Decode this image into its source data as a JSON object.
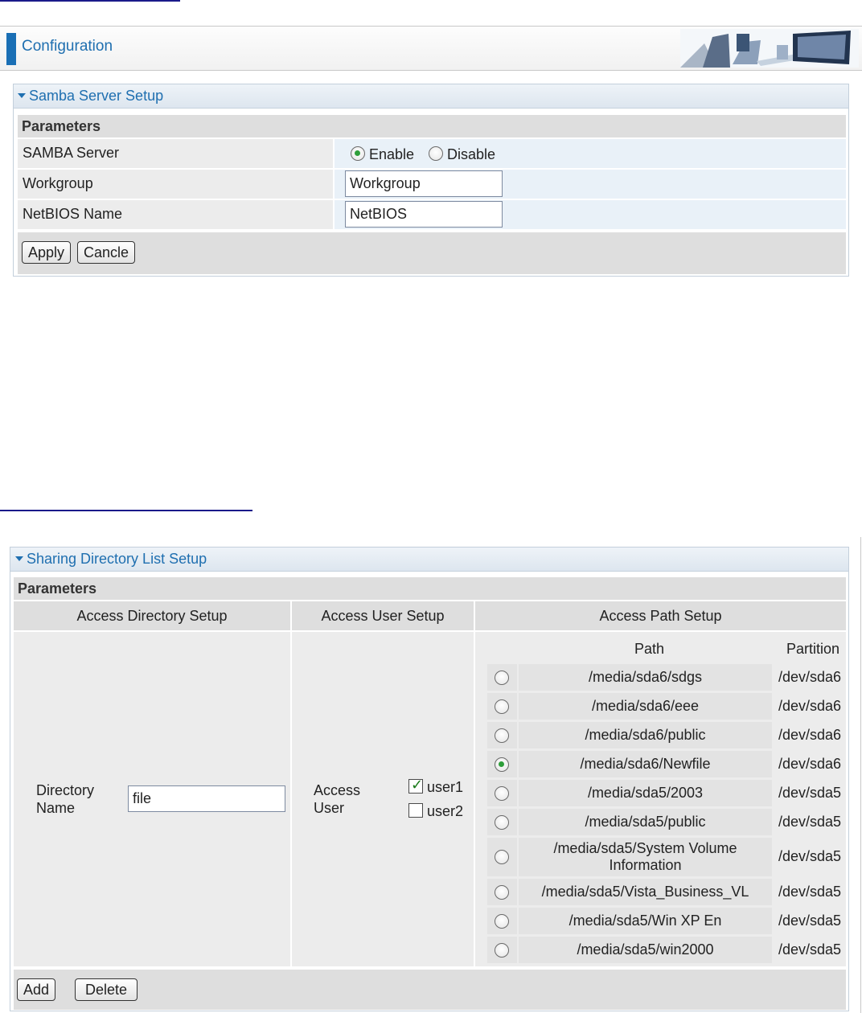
{
  "config": {
    "title": "Configuration"
  },
  "samba_panel": {
    "title": "Samba Server Setup",
    "params_label": "Parameters",
    "rows": {
      "samba_server": {
        "label": "SAMBA Server",
        "enable": "Enable",
        "disable": "Disable",
        "selected": "Enable"
      },
      "workgroup": {
        "label": "Workgroup",
        "value": "Workgroup"
      },
      "netbios": {
        "label": "NetBIOS Name",
        "value": "NetBIOS"
      }
    },
    "buttons": {
      "apply": "Apply",
      "cancel": "Cancle"
    }
  },
  "sharing_panel": {
    "title": "Sharing Directory List Setup",
    "params_label": "Parameters",
    "columns": {
      "directory": "Access Directory Setup",
      "user": "Access User Setup",
      "path": "Access Path Setup"
    },
    "directory_name": {
      "label_line1": "Directory",
      "label_line2": "Name",
      "value": "file"
    },
    "access_user": {
      "label_line1": "Access",
      "label_line2": "User",
      "users": [
        {
          "name": "user1",
          "checked": true
        },
        {
          "name": "user2",
          "checked": false
        }
      ]
    },
    "path_table": {
      "path_header": "Path",
      "partition_header": "Partition",
      "rows": [
        {
          "path": "/media/sda6/sdgs",
          "partition": "/dev/sda6",
          "selected": false
        },
        {
          "path": "/media/sda6/eee",
          "partition": "/dev/sda6",
          "selected": false
        },
        {
          "path": "/media/sda6/public",
          "partition": "/dev/sda6",
          "selected": false
        },
        {
          "path": "/media/sda6/Newfile",
          "partition": "/dev/sda6",
          "selected": true
        },
        {
          "path": "/media/sda5/2003",
          "partition": "/dev/sda5",
          "selected": false
        },
        {
          "path": "/media/sda5/public",
          "partition": "/dev/sda5",
          "selected": false
        },
        {
          "path": "/media/sda5/System Volume Information",
          "partition": "/dev/sda5",
          "selected": false
        },
        {
          "path": "/media/sda5/Vista_Business_VL",
          "partition": "/dev/sda5",
          "selected": false
        },
        {
          "path": "/media/sda5/Win XP En",
          "partition": "/dev/sda5",
          "selected": false
        },
        {
          "path": "/media/sda5/win2000",
          "partition": "/dev/sda5",
          "selected": false
        }
      ]
    },
    "buttons": {
      "add": "Add",
      "delete": "Delete"
    }
  }
}
